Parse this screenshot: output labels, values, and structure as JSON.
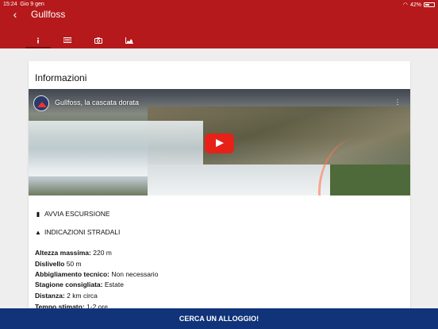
{
  "status": {
    "time": "15:24",
    "date": "Gio 9 gen",
    "battery": "42%"
  },
  "header": {
    "title": "Gullfoss",
    "tabs": [
      {
        "icon": "info-icon",
        "active": true
      },
      {
        "icon": "list-icon",
        "active": false
      },
      {
        "icon": "camera-icon",
        "active": false
      },
      {
        "icon": "chart-icon",
        "active": false
      }
    ]
  },
  "card": {
    "title": "Informazioni",
    "video": {
      "title": "Gullfoss, la cascata dorata"
    },
    "actions": {
      "start": "AVVIA ESCURSIONE",
      "directions": "INDICAZIONI STRADALI"
    },
    "details": [
      {
        "label": "Altezza massima:",
        "value": "220 m"
      },
      {
        "label": "Dislivello",
        "value": "50 m"
      },
      {
        "label": "Abbigliamento tecnico:",
        "value": "Non necessario"
      },
      {
        "label": "Stagione consigliata:",
        "value": "Estate"
      },
      {
        "label": "Distanza:",
        "value": "2 km circa"
      },
      {
        "label": "Tempo stimato:",
        "value": "1-2 ore"
      }
    ]
  },
  "bottom": {
    "label": "CERCA UN ALLOGGIO!"
  },
  "colors": {
    "header": "#b5191b",
    "bottom_bar": "#10337a",
    "youtube_red": "#e62117"
  }
}
